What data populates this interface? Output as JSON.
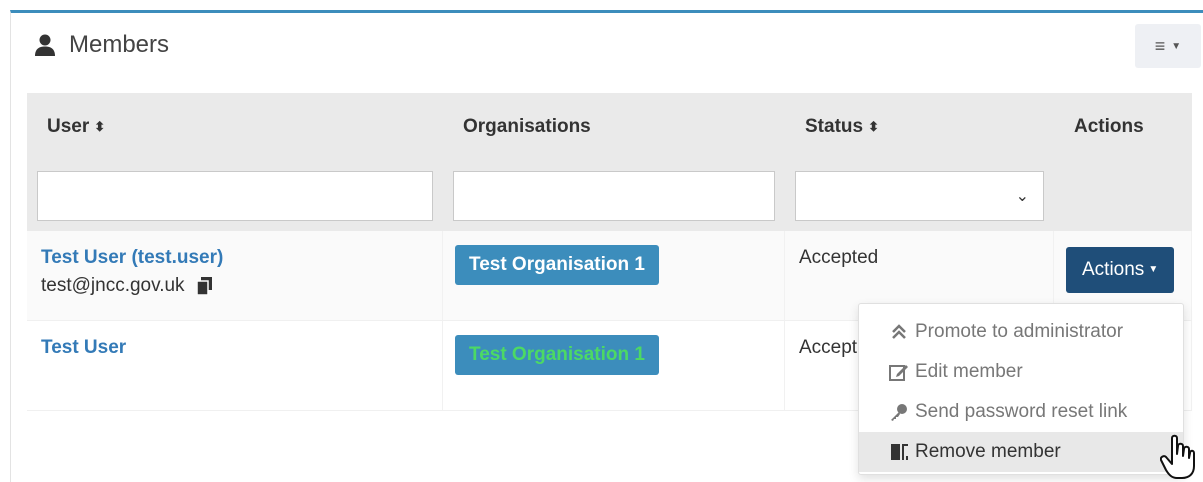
{
  "header": {
    "title": "Members",
    "title_icon": "user-icon",
    "menu_icon": "hamburger-icon"
  },
  "table": {
    "columns": [
      {
        "label": "User",
        "sortable": true
      },
      {
        "label": "Organisations",
        "sortable": false
      },
      {
        "label": "Status",
        "sortable": true
      },
      {
        "label": "Actions",
        "sortable": false
      }
    ],
    "filters": {
      "user": "",
      "organisation": "",
      "status": ""
    },
    "rows": [
      {
        "user": "Test User (test.user)",
        "email": "test@jncc.gov.uk",
        "organisation": "Test Organisation 1",
        "status": "Accepted",
        "actions_label": "Actions"
      },
      {
        "user": "Test User",
        "organisation": "Test Organisation 1",
        "status": "Accept"
      }
    ]
  },
  "dropdown": {
    "items": [
      {
        "label": "Promote to administrator",
        "icon": "double-chevron-up-icon"
      },
      {
        "label": "Edit member",
        "icon": "edit-icon"
      },
      {
        "label": "Send password reset link",
        "icon": "key-icon"
      },
      {
        "label": "Remove member",
        "icon": "door-exit-icon",
        "active": true
      }
    ]
  },
  "colors": {
    "accent": "#3c8dbc",
    "button_dark": "#1f4e79",
    "link": "#337ab7",
    "green_text": "#4cd964"
  }
}
